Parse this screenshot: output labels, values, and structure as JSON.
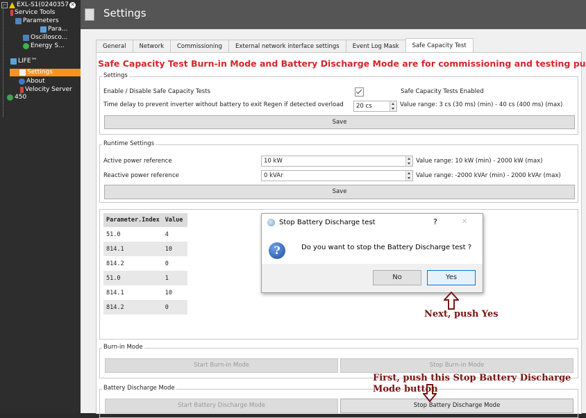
{
  "sidebar": {
    "items": [
      {
        "label": "EXL-S1(0240357",
        "icon": "warning-icon"
      },
      {
        "label": "Service Tools",
        "icon": "tools-icon"
      },
      {
        "label": "Parameters",
        "icon": "parameters-icon"
      },
      {
        "label": "Para...",
        "icon": "parameter-icon"
      },
      {
        "label": "Oscillosco...",
        "icon": "oscilloscope-icon"
      },
      {
        "label": "Energy S...",
        "icon": "energy-icon"
      },
      {
        "label": "LIFE™",
        "icon": "life-icon"
      },
      {
        "label": "Settings",
        "icon": "settings-icon"
      },
      {
        "label": "About",
        "icon": "about-icon"
      },
      {
        "label": "Velocity Server",
        "icon": "server-icon"
      },
      {
        "label": "450",
        "icon": "device-icon"
      }
    ]
  },
  "header": {
    "title": "Settings"
  },
  "tabs": [
    "General",
    "Network",
    "Commissioning",
    "External network interface settings",
    "Event Log Mask",
    "Safe Capacity Test"
  ],
  "active_tab": "Safe Capacity Test",
  "warning": "Safe Capacity Test Burn-in Mode and Battery Discharge Mode are for commissioning and testing purpose",
  "settings": {
    "title": "Settings",
    "enable_label": "Enable / Disable Safe Capacity Tests",
    "enable_checked": true,
    "enable_status": "Safe Capacity Tests Enabled",
    "delay_label": "Time delay to prevent inverter without battery to exit Regen if detected overload",
    "delay_value": "20 cs",
    "delay_range": "Value range: 3 cs (30 ms) (min) - 40 cs (400 ms) (max)",
    "save_label": "Save"
  },
  "runtime": {
    "title": "Runtime Settings",
    "active_label": "Active power reference",
    "active_value": "10 kW",
    "active_range": "Value range: 10 kW (min) - 2000 kW (max)",
    "reactive_label": "Reactive power reference",
    "reactive_value": "0 kVAr",
    "reactive_range": "Value range: -2000 kVAr (min) - 2000 kVAr (max)",
    "save_label": "Save"
  },
  "param_table": {
    "headers": [
      "Parameter.Index",
      "Value"
    ],
    "rows": [
      [
        "51.0",
        "4"
      ],
      [
        "814.1",
        "10"
      ],
      [
        "814.2",
        "0"
      ],
      [
        "51.0",
        "1"
      ],
      [
        "814.1",
        "10"
      ],
      [
        "814.2",
        "0"
      ]
    ]
  },
  "burnin": {
    "title": "Burn-in Mode",
    "start_label": "Start Burn-in Mode",
    "stop_label": "Stop Burn-in Mode"
  },
  "discharge": {
    "title": "Battery Discharge Mode",
    "start_label": "Start Battery Discharge Mode",
    "stop_label": "Stop Battery Discharge Mode"
  },
  "dialog": {
    "title": "Stop Battery Discharge test",
    "help": "?",
    "close": "✕",
    "message": "Do you want to stop the Battery Discharge test ?",
    "no_label": "No",
    "yes_label": "Yes"
  },
  "annotations": {
    "next": "Next, push Yes",
    "first_line1": "First, push this Stop Battery Discharge",
    "first_line2": "Mode button"
  },
  "colors": {
    "warning": "#d9252a",
    "selected": "#f7941d",
    "annotation": "#7a1414"
  }
}
